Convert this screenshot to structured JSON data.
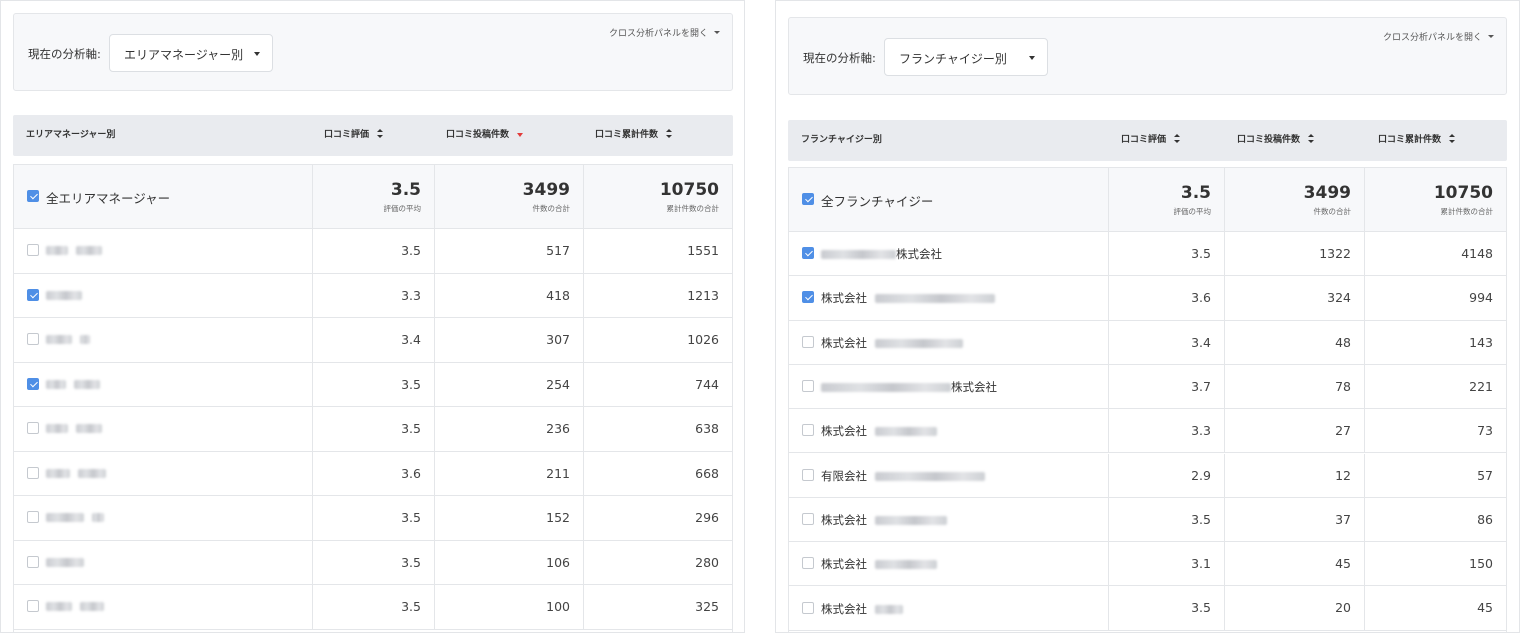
{
  "left": {
    "axis_label": "現在の分析軸:",
    "axis_value": "エリアマネージャー別",
    "cross_panel": "クロス分析パネルを開く",
    "columns": [
      "エリアマネージャー別",
      "口コミ評価",
      "口コミ投稿件数",
      "口コミ累計件数"
    ],
    "total": {
      "label": "全エリアマネージャー",
      "rating": "3.5",
      "rating_sub": "評価の平均",
      "posts": "3499",
      "posts_sub": "件数の合計",
      "cumulative": "10750",
      "cumulative_sub": "累計件数の合計"
    },
    "rows": [
      {
        "rating": "3.5",
        "posts": "517",
        "cumulative": "1551"
      },
      {
        "rating": "3.3",
        "posts": "418",
        "cumulative": "1213"
      },
      {
        "rating": "3.4",
        "posts": "307",
        "cumulative": "1026"
      },
      {
        "rating": "3.5",
        "posts": "254",
        "cumulative": "744"
      },
      {
        "rating": "3.5",
        "posts": "236",
        "cumulative": "638"
      },
      {
        "rating": "3.6",
        "posts": "211",
        "cumulative": "668"
      },
      {
        "rating": "3.5",
        "posts": "152",
        "cumulative": "296"
      },
      {
        "rating": "3.5",
        "posts": "106",
        "cumulative": "280"
      },
      {
        "rating": "3.5",
        "posts": "100",
        "cumulative": "325"
      }
    ]
  },
  "right": {
    "axis_label": "現在の分析軸:",
    "axis_value": "フランチャイジー別",
    "cross_panel": "クロス分析パネルを開く",
    "columns": [
      "フランチャイジー別",
      "口コミ評価",
      "口コミ投稿件数",
      "口コミ累計件数"
    ],
    "total": {
      "label": "全フランチャイジー",
      "rating": "3.5",
      "rating_sub": "評価の平均",
      "posts": "3499",
      "posts_sub": "件数の合計",
      "cumulative": "10750",
      "cumulative_sub": "累計件数の合計"
    },
    "rows": [
      {
        "suffix": "株式会社",
        "rating": "3.5",
        "posts": "1322",
        "cumulative": "4148"
      },
      {
        "prefix": "株式会社",
        "rating": "3.6",
        "posts": "324",
        "cumulative": "994"
      },
      {
        "prefix": "株式会社",
        "rating": "3.4",
        "posts": "48",
        "cumulative": "143"
      },
      {
        "suffix": "株式会社",
        "rating": "3.7",
        "posts": "78",
        "cumulative": "221"
      },
      {
        "prefix": "株式会社",
        "rating": "3.3",
        "posts": "27",
        "cumulative": "73"
      },
      {
        "prefix": "有限会社",
        "rating": "2.9",
        "posts": "12",
        "cumulative": "57"
      },
      {
        "prefix": "株式会社",
        "rating": "3.5",
        "posts": "37",
        "cumulative": "86"
      },
      {
        "prefix": "株式会社",
        "rating": "3.1",
        "posts": "45",
        "cumulative": "150"
      },
      {
        "prefix": "株式会社",
        "rating": "3.5",
        "posts": "20",
        "cumulative": "45"
      }
    ]
  }
}
